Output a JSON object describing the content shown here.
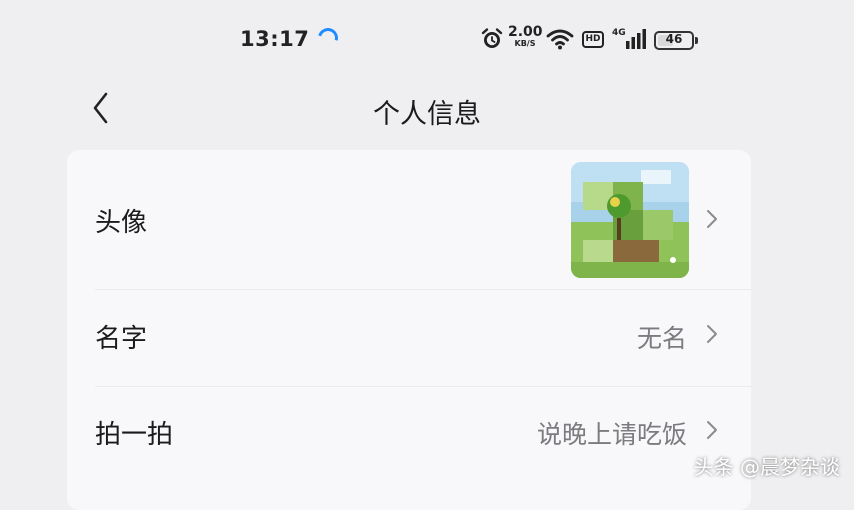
{
  "status_bar": {
    "time": "13:17",
    "speed_value": "2.00",
    "speed_unit": "KB/S",
    "hd_label": "HD",
    "network_label": "4G",
    "battery_level": "46"
  },
  "nav": {
    "title": "个人信息"
  },
  "rows": [
    {
      "label": "头像",
      "value": ""
    },
    {
      "label": "名字",
      "value": "无名"
    },
    {
      "label": "拍一拍",
      "value": "说晚上请吃饭"
    }
  ],
  "watermark": "头条 @晨梦杂谈",
  "colors": {
    "background": "#efeff1",
    "card": "#f8f8fa",
    "secondary_text": "#7b7b80",
    "loading_accent": "#1f8cff"
  }
}
